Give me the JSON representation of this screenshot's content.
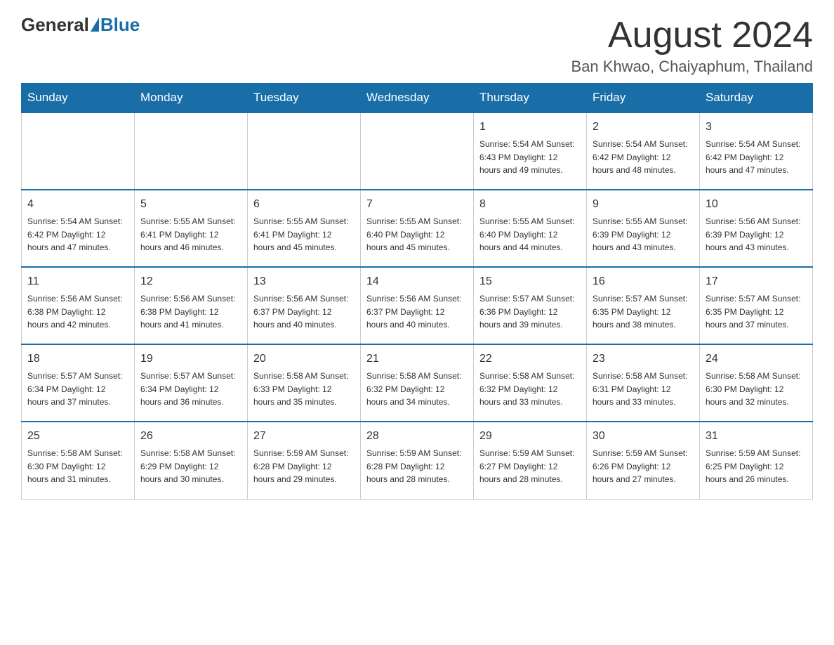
{
  "header": {
    "logo_general": "General",
    "logo_blue": "Blue",
    "month_title": "August 2024",
    "location": "Ban Khwao, Chaiyaphum, Thailand"
  },
  "weekdays": [
    "Sunday",
    "Monday",
    "Tuesday",
    "Wednesday",
    "Thursday",
    "Friday",
    "Saturday"
  ],
  "weeks": [
    [
      {
        "day": "",
        "info": ""
      },
      {
        "day": "",
        "info": ""
      },
      {
        "day": "",
        "info": ""
      },
      {
        "day": "",
        "info": ""
      },
      {
        "day": "1",
        "info": "Sunrise: 5:54 AM\nSunset: 6:43 PM\nDaylight: 12 hours\nand 49 minutes."
      },
      {
        "day": "2",
        "info": "Sunrise: 5:54 AM\nSunset: 6:42 PM\nDaylight: 12 hours\nand 48 minutes."
      },
      {
        "day": "3",
        "info": "Sunrise: 5:54 AM\nSunset: 6:42 PM\nDaylight: 12 hours\nand 47 minutes."
      }
    ],
    [
      {
        "day": "4",
        "info": "Sunrise: 5:54 AM\nSunset: 6:42 PM\nDaylight: 12 hours\nand 47 minutes."
      },
      {
        "day": "5",
        "info": "Sunrise: 5:55 AM\nSunset: 6:41 PM\nDaylight: 12 hours\nand 46 minutes."
      },
      {
        "day": "6",
        "info": "Sunrise: 5:55 AM\nSunset: 6:41 PM\nDaylight: 12 hours\nand 45 minutes."
      },
      {
        "day": "7",
        "info": "Sunrise: 5:55 AM\nSunset: 6:40 PM\nDaylight: 12 hours\nand 45 minutes."
      },
      {
        "day": "8",
        "info": "Sunrise: 5:55 AM\nSunset: 6:40 PM\nDaylight: 12 hours\nand 44 minutes."
      },
      {
        "day": "9",
        "info": "Sunrise: 5:55 AM\nSunset: 6:39 PM\nDaylight: 12 hours\nand 43 minutes."
      },
      {
        "day": "10",
        "info": "Sunrise: 5:56 AM\nSunset: 6:39 PM\nDaylight: 12 hours\nand 43 minutes."
      }
    ],
    [
      {
        "day": "11",
        "info": "Sunrise: 5:56 AM\nSunset: 6:38 PM\nDaylight: 12 hours\nand 42 minutes."
      },
      {
        "day": "12",
        "info": "Sunrise: 5:56 AM\nSunset: 6:38 PM\nDaylight: 12 hours\nand 41 minutes."
      },
      {
        "day": "13",
        "info": "Sunrise: 5:56 AM\nSunset: 6:37 PM\nDaylight: 12 hours\nand 40 minutes."
      },
      {
        "day": "14",
        "info": "Sunrise: 5:56 AM\nSunset: 6:37 PM\nDaylight: 12 hours\nand 40 minutes."
      },
      {
        "day": "15",
        "info": "Sunrise: 5:57 AM\nSunset: 6:36 PM\nDaylight: 12 hours\nand 39 minutes."
      },
      {
        "day": "16",
        "info": "Sunrise: 5:57 AM\nSunset: 6:35 PM\nDaylight: 12 hours\nand 38 minutes."
      },
      {
        "day": "17",
        "info": "Sunrise: 5:57 AM\nSunset: 6:35 PM\nDaylight: 12 hours\nand 37 minutes."
      }
    ],
    [
      {
        "day": "18",
        "info": "Sunrise: 5:57 AM\nSunset: 6:34 PM\nDaylight: 12 hours\nand 37 minutes."
      },
      {
        "day": "19",
        "info": "Sunrise: 5:57 AM\nSunset: 6:34 PM\nDaylight: 12 hours\nand 36 minutes."
      },
      {
        "day": "20",
        "info": "Sunrise: 5:58 AM\nSunset: 6:33 PM\nDaylight: 12 hours\nand 35 minutes."
      },
      {
        "day": "21",
        "info": "Sunrise: 5:58 AM\nSunset: 6:32 PM\nDaylight: 12 hours\nand 34 minutes."
      },
      {
        "day": "22",
        "info": "Sunrise: 5:58 AM\nSunset: 6:32 PM\nDaylight: 12 hours\nand 33 minutes."
      },
      {
        "day": "23",
        "info": "Sunrise: 5:58 AM\nSunset: 6:31 PM\nDaylight: 12 hours\nand 33 minutes."
      },
      {
        "day": "24",
        "info": "Sunrise: 5:58 AM\nSunset: 6:30 PM\nDaylight: 12 hours\nand 32 minutes."
      }
    ],
    [
      {
        "day": "25",
        "info": "Sunrise: 5:58 AM\nSunset: 6:30 PM\nDaylight: 12 hours\nand 31 minutes."
      },
      {
        "day": "26",
        "info": "Sunrise: 5:58 AM\nSunset: 6:29 PM\nDaylight: 12 hours\nand 30 minutes."
      },
      {
        "day": "27",
        "info": "Sunrise: 5:59 AM\nSunset: 6:28 PM\nDaylight: 12 hours\nand 29 minutes."
      },
      {
        "day": "28",
        "info": "Sunrise: 5:59 AM\nSunset: 6:28 PM\nDaylight: 12 hours\nand 28 minutes."
      },
      {
        "day": "29",
        "info": "Sunrise: 5:59 AM\nSunset: 6:27 PM\nDaylight: 12 hours\nand 28 minutes."
      },
      {
        "day": "30",
        "info": "Sunrise: 5:59 AM\nSunset: 6:26 PM\nDaylight: 12 hours\nand 27 minutes."
      },
      {
        "day": "31",
        "info": "Sunrise: 5:59 AM\nSunset: 6:25 PM\nDaylight: 12 hours\nand 26 minutes."
      }
    ]
  ]
}
